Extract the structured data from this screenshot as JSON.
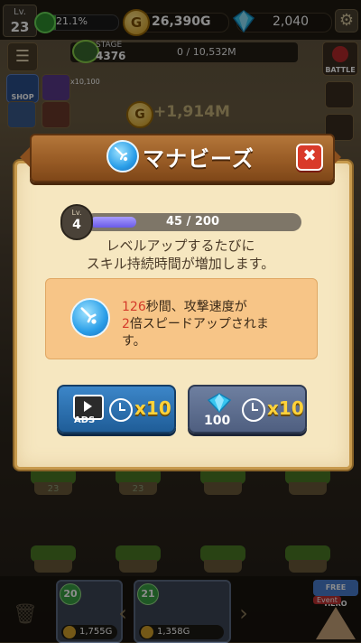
{
  "hud": {
    "lv_label": "Lv.",
    "level": "23",
    "xp_percent": "21.1%",
    "xp_fraction": 0.211,
    "gold": "26,390G",
    "gems": "2,040",
    "stage_label": "STAGE",
    "stage_number": "4376",
    "stage_progress": "0 / 10,532M",
    "battle_label": "BATTLE",
    "shop_label": "SHOP",
    "gold_gain": "+1,914M",
    "extra_label": "x10,100"
  },
  "modal": {
    "title": "マナビーズ",
    "close_symbol": "✖",
    "level_label": "Lv.",
    "level": "4",
    "progress_text": "45 / 200",
    "progress_fraction": 0.225,
    "description_line1": "レベルアップするたびに",
    "description_line2": "スキル持続時間が増加します。",
    "effect_seconds": "126",
    "effect_line1_rest": "秒間、攻撃速度が",
    "effect_multiplier": "2",
    "effect_line2_rest": "倍スピードアップされま",
    "effect_line3": "す。",
    "ads_label": "ADS",
    "ads_multiplier": "x10",
    "gem_cost": "100",
    "gem_multiplier": "x10"
  },
  "bottom": {
    "island_levels": [
      "23",
      "23"
    ],
    "hero_cards": [
      {
        "level": "20",
        "price": "1,755G"
      },
      {
        "level": "21",
        "price": "1,358G"
      }
    ],
    "free_hero_label": "FREE HERO",
    "event_label": "Event"
  },
  "colors": {
    "modal_bg": "#f6e7c0",
    "banner": "#9b5e27",
    "effect_bg": "#f7c587",
    "highlight_red": "#d43a2a",
    "progress_purple": "#6a5be8",
    "ads_button": "#1f5d98",
    "gem_button": "#4f5f80"
  },
  "icons": {
    "title_icon": "mana-beads-icon",
    "close_icon": "close-icon",
    "ads_icon": "video-ad-icon",
    "clock_icon": "timer-icon",
    "gem_icon": "diamond-icon"
  }
}
